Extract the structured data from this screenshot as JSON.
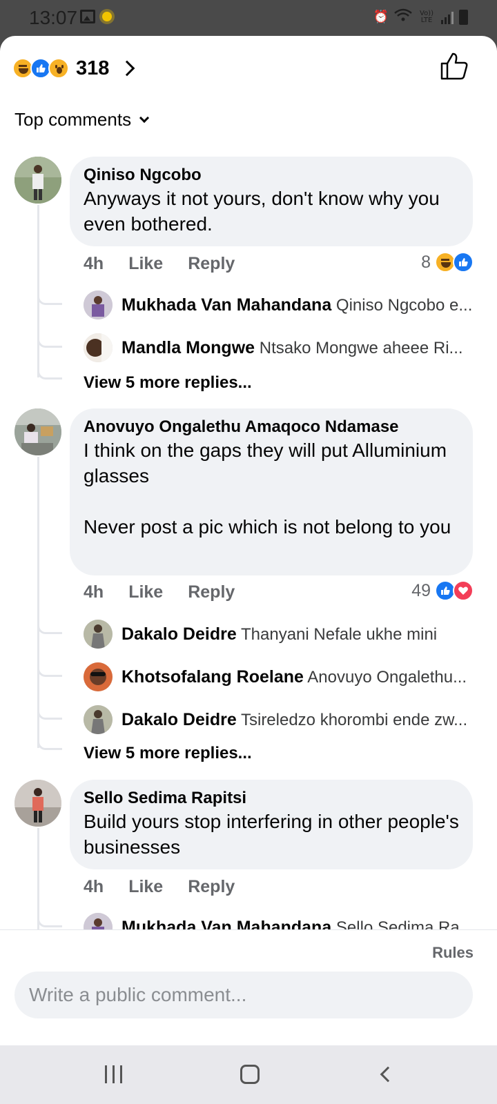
{
  "status_bar": {
    "time": "13:07",
    "network_label": "Vo)) LTE"
  },
  "reactions_summary": {
    "count": "318",
    "types": [
      "haha-icon",
      "like-icon",
      "wow-icon"
    ]
  },
  "sort": {
    "label": "Top comments"
  },
  "comments": [
    {
      "author": "Qiniso Ngcobo",
      "text": "Anyways it not yours, don't know why you even bothered.",
      "time": "4h",
      "like_label": "Like",
      "reply_label": "Reply",
      "reaction_count": "8",
      "reaction_types": [
        "haha-icon",
        "like-icon"
      ],
      "replies": [
        {
          "author": "Mukhada Van Mahandana",
          "text": "Qiniso Ngcobo e..."
        },
        {
          "author": "Mandla Mongwe",
          "text": "Ntsako Mongwe aheee Ri..."
        }
      ],
      "more_replies": "View 5 more replies..."
    },
    {
      "author": "Anovuyo Ongalethu Amaqoco Ndamase",
      "text": "I think on the gaps they will put Alluminium glasses\n\nNever post a pic which is not belong to you",
      "time": "4h",
      "like_label": "Like",
      "reply_label": "Reply",
      "reaction_count": "49",
      "reaction_types": [
        "like-icon",
        "love-icon"
      ],
      "replies": [
        {
          "author": "Dakalo Deidre",
          "text": "Thanyani Nefale ukhe mini"
        },
        {
          "author": "Khotsofalang Roelane",
          "text": "Anovuyo Ongalethu..."
        },
        {
          "author": "Dakalo Deidre",
          "text": "Tsireledzo khorombi ende zw..."
        }
      ],
      "more_replies": "View 5 more replies..."
    },
    {
      "author": "Sello Sedima Rapitsi",
      "text": "Build yours stop interfering in other people's businesses",
      "time": "4h",
      "like_label": "Like",
      "reply_label": "Reply",
      "replies": [
        {
          "author": "Mukhada Van Mahandana",
          "text": "Sello Sedima Ra..."
        }
      ]
    }
  ],
  "footer": {
    "rules_label": "Rules",
    "comment_placeholder": "Write a public comment..."
  },
  "colors": {
    "like_blue": "#1877f2",
    "bubble_bg": "#f0f2f5",
    "muted_text": "#65676b",
    "haha_yellow": "#f7b125",
    "love_red": "#f33e58"
  }
}
